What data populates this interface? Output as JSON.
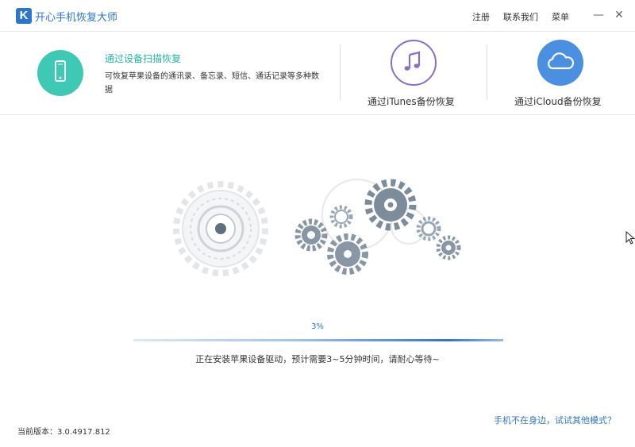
{
  "app": {
    "title": "开心手机恢复大师",
    "logo_letter": "K"
  },
  "menu": {
    "register": "注册",
    "contact": "联系我们",
    "menu": "菜单"
  },
  "window": {
    "minimize": "—",
    "close": "✕"
  },
  "modes": {
    "scan": {
      "title": "通过设备扫描恢复",
      "description": "可恢复苹果设备的通讯录、备忘录、短信、通话记录等多种数据",
      "icon": "phone-icon",
      "color": "#3ec9b4"
    },
    "itunes": {
      "label": "通过iTunes备份恢复",
      "icon": "music-note-icon",
      "color": "#8a6fc4"
    },
    "icloud": {
      "label": "通过iCloud备份恢复",
      "icon": "cloud-icon",
      "color": "#4a8fe0"
    }
  },
  "progress": {
    "percent_text": "3%",
    "value": 0.03,
    "status": "正在安装苹果设备驱动，预计需要3~5分钟时间，请耐心等待~"
  },
  "footer": {
    "version": "当前版本：3.0.4917.812",
    "alt_link": "手机不在身边，试试其他模式？"
  }
}
